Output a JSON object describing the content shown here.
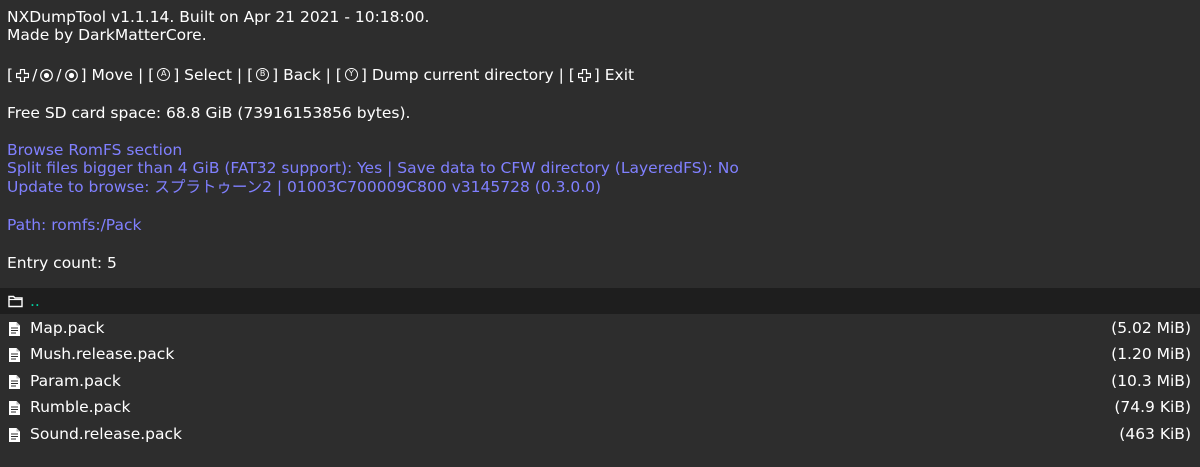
{
  "header": {
    "title": "NXDumpTool v1.1.14. Built on Apr 21 2021 - 10:18:00.",
    "author": "Made by DarkMatterCore."
  },
  "controls": {
    "open_bracket": "[",
    "slash": "/",
    "move": "] Move | [",
    "a_glyph": "A",
    "select": "] Select | [",
    "b_glyph": "B",
    "back": "] Back | [",
    "y_glyph": "Y",
    "dump": "] Dump current directory | [",
    "exit": "] Exit"
  },
  "status": {
    "free_space": "Free SD card space: 68.8 GiB (73916153856 bytes)."
  },
  "romfs": {
    "section": "Browse RomFS section",
    "options": "Split files bigger than 4 GiB (FAT32 support): Yes | Save data to CFW directory (LayeredFS): No",
    "update": "Update to browse: スプラトゥーン2 | 01003C700009C800 v3145728 (0.3.0.0)",
    "path": "Path: romfs:/Pack"
  },
  "entry_count": "Entry count: 5",
  "parent_entry": {
    "icon": "folder-icon",
    "name": ".."
  },
  "entries": [
    {
      "icon": "file-icon",
      "name": "Map.pack",
      "size": "(5.02 MiB)"
    },
    {
      "icon": "file-icon",
      "name": "Mush.release.pack",
      "size": "(1.20 MiB)"
    },
    {
      "icon": "file-icon",
      "name": "Param.pack",
      "size": "(10.3 MiB)"
    },
    {
      "icon": "file-icon",
      "name": "Rumble.pack",
      "size": "(74.9 KiB)"
    },
    {
      "icon": "file-icon",
      "name": "Sound.release.pack",
      "size": "(463 KiB)"
    }
  ],
  "colors": {
    "background": "#2d2d2d",
    "text": "#ffffff",
    "highlight_text": "#8080ff",
    "selected_row_bg": "#1e1e1e",
    "parent_entry_text": "#00d0a0"
  }
}
